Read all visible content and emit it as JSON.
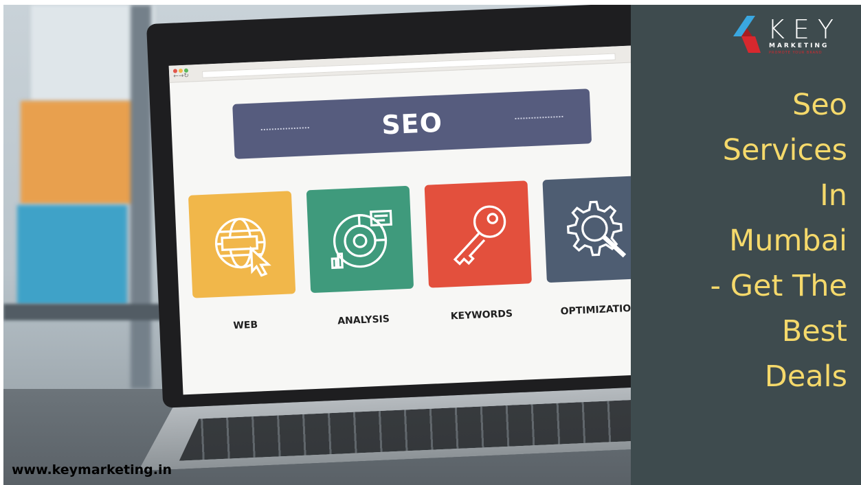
{
  "laptop_screen": {
    "banner_title": "SEO",
    "tiles": [
      {
        "label": "WEB",
        "icon": "globe-cursor-icon",
        "color": "#f1b74a"
      },
      {
        "label": "ANALYSIS",
        "icon": "analysis-chart-icon",
        "color": "#3f9a7c"
      },
      {
        "label": "KEYWORDS",
        "icon": "key-icon",
        "color": "#e3503d"
      },
      {
        "label": "OPTIMIZATION",
        "icon": "gear-magnifier-icon",
        "color": "#4e5d72"
      }
    ]
  },
  "website": "www.keymarketing.in",
  "logo": {
    "word": "KEY",
    "sub": "MARKETING",
    "tagline": "PROMOTE YOUR BRAND",
    "accent_color": "#d8282e"
  },
  "headline": {
    "lines": [
      "Seo",
      "Services",
      "In",
      "Mumbai",
      "- Get The",
      "Best",
      "Deals"
    ],
    "color": "#f5d96b"
  },
  "panel_color": "#3e4b4e"
}
